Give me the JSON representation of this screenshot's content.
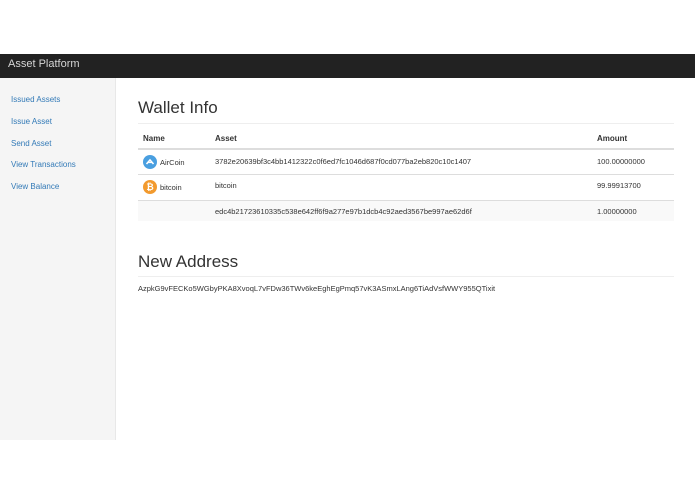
{
  "navbar": {
    "brand": "Asset Platform"
  },
  "sidebar": {
    "items": [
      {
        "label": "Issued Assets"
      },
      {
        "label": "Issue Asset"
      },
      {
        "label": "Send Asset"
      },
      {
        "label": "View Transactions"
      },
      {
        "label": "View Balance"
      }
    ]
  },
  "wallet": {
    "title": "Wallet Info",
    "columns": {
      "name": "Name",
      "asset": "Asset",
      "amount": "Amount"
    },
    "rows": [
      {
        "name": "AirCoin",
        "icon": "aircoin-icon",
        "icon_color": "#4a9fe0",
        "asset": "3782e20639bf3c4bb1412322c0f6ed7fc1046d687f0cd077ba2eb820c10c1407",
        "amount": "100.00000000"
      },
      {
        "name": "bitcoin",
        "icon": "bitcoin-icon",
        "icon_color": "#f29a2e",
        "asset": "bitcoin",
        "amount": "99.99913700"
      },
      {
        "name": "",
        "asset": "edc4b21723610335c538e642ff6f9a277e97b1dcb4c92aed3567be997ae62d6f",
        "amount": "1.00000000"
      }
    ]
  },
  "new_address": {
    "title": "New Address",
    "value": "AzpkG9vFECKo5WGbyPKA8XvoqL7vFDw36TWv6keEghEgPmq57vK3ASmxLAng6TiAdVsfWWY955QTixit"
  }
}
